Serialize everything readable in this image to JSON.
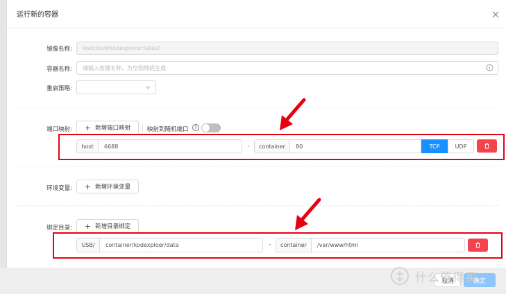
{
  "dialog": {
    "title": "运行新的容器",
    "close_icon": "close-icon"
  },
  "form": {
    "image_label": "镜像名称:",
    "image_value": "kodcloud/kodexplorer:latest",
    "container_label": "容器名称:",
    "container_placeholder": "请输入容器名称，为空则随机生成",
    "restart_label": "重启策略:",
    "restart_value": ""
  },
  "ports": {
    "label": "端口映射:",
    "add_button": "新增端口映射",
    "random_label": "映射到随机端口",
    "random_enabled": false,
    "rows": [
      {
        "host_addon": "host",
        "host_value": "6688",
        "separator": "-",
        "container_addon": "container",
        "container_value": "80",
        "tcp": "TCP",
        "udp": "UDP",
        "protocol": "TCP"
      }
    ]
  },
  "env": {
    "label": "环境变量:",
    "add_button": "新增环境变量"
  },
  "volumes": {
    "label": "绑定目录:",
    "add_button": "新增目录绑定",
    "rows": [
      {
        "prefix": "USB/",
        "host_path": "container/kodexploer/data",
        "separator": "-",
        "container_addon": "container",
        "container_path": "/var/www/html"
      }
    ]
  },
  "footer": {
    "cancel": "取消",
    "submit": "确定"
  },
  "watermark": "什么值得买",
  "colors": {
    "accent": "#1890ff",
    "danger": "#f5434e",
    "highlight": "#e60012"
  }
}
